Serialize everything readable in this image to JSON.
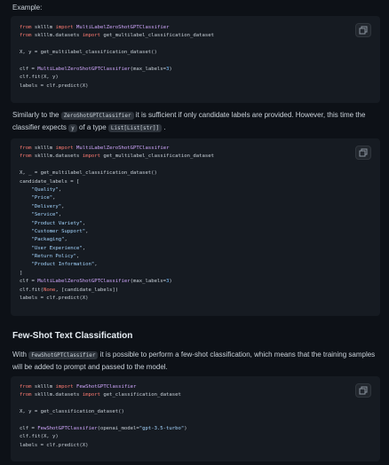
{
  "intro": {
    "example_label": "Example:"
  },
  "block1": {
    "lines": [
      [
        "kw:from",
        "t: sklllm ",
        "kw:import",
        "t: ",
        "cls:MultiLabelZeroShotGPTClassifier"
      ],
      [
        "kw:from",
        "t: sklllm.datasets ",
        "kw:import",
        "t: get_multilabel_classification_dataset"
      ],
      [],
      [
        "t:X, y = get_multilabel_classification_dataset()"
      ],
      [],
      [
        "t:clf = ",
        "cls:MultiLabelZeroShotGPTClassifier",
        "t:(max_labels=",
        "num:3",
        "t:)"
      ],
      [
        "t:clf.fit(X, y)"
      ],
      [
        "t:labels = clf.predict(X)"
      ]
    ]
  },
  "para1": {
    "part1": "Similarly to the ",
    "code1": "ZeroShotGPTClassifier",
    "part2": " it is sufficient if only candidate labels are provided. However, this time the classifier expects ",
    "code2": "y",
    "part3": " of a type ",
    "code3": "List[List[str]]",
    "part4": " ."
  },
  "block2": {
    "lines": [
      [
        "kw:from",
        "t: sklllm ",
        "kw:import",
        "t: ",
        "cls:MultiLabelZeroShotGPTClassifier"
      ],
      [
        "kw:from",
        "t: sklllm.datasets ",
        "kw:import",
        "t: get_multilabel_classification_dataset"
      ],
      [],
      [
        "t:X, _ = get_multilabel_classification_dataset()"
      ],
      [
        "t:candidate_labels = ["
      ],
      [
        "t:    ",
        "str:\"Quality\"",
        "t:,"
      ],
      [
        "t:    ",
        "str:\"Price\"",
        "t:,"
      ],
      [
        "t:    ",
        "str:\"Delivery\"",
        "t:,"
      ],
      [
        "t:    ",
        "str:\"Service\"",
        "t:,"
      ],
      [
        "t:    ",
        "str:\"Product Variety\"",
        "t:,"
      ],
      [
        "t:    ",
        "str:\"Customer Support\"",
        "t:,"
      ],
      [
        "t:    ",
        "str:\"Packaging\"",
        "t:,"
      ],
      [
        "t:    ",
        "str:\"User Experience\"",
        "t:,"
      ],
      [
        "t:    ",
        "str:\"Return Policy\"",
        "t:,"
      ],
      [
        "t:    ",
        "str:\"Product Information\"",
        "t:,"
      ],
      [
        "t:]"
      ],
      [
        "t:clf = ",
        "cls:MultiLabelZeroShotGPTClassifier",
        "t:(max_labels=",
        "num:3",
        "t:)"
      ],
      [
        "t:clf.fit(",
        "kw:None",
        "t:, [candidate_labels])"
      ],
      [
        "t:labels = clf.predict(X)"
      ]
    ]
  },
  "section": {
    "title": "Few-Shot Text Classification"
  },
  "para2": {
    "part1": "With ",
    "code1": "FewShotGPTClassifier",
    "part2": " it is possible to perform a few-shot classification, which means that the training samples will be added to prompt and passed to the model."
  },
  "block3": {
    "lines": [
      [
        "kw:from",
        "t: sklllm ",
        "kw:import",
        "t: ",
        "cls:FewShotGPTClassifier"
      ],
      [
        "kw:from",
        "t: sklllm.datasets ",
        "kw:import",
        "t: get_classification_dataset"
      ],
      [],
      [
        "t:X, y = get_classification_dataset()"
      ],
      [],
      [
        "t:clf = ",
        "cls:FewShotGPTClassifier",
        "t:(openai_model=",
        "str:\"gpt-3.5-turbo\"",
        "t:)"
      ],
      [
        "t:clf.fit(X, y)"
      ],
      [
        "t:labels = clf.predict(X)"
      ]
    ]
  },
  "icons": {
    "copy": "copy-icon"
  }
}
